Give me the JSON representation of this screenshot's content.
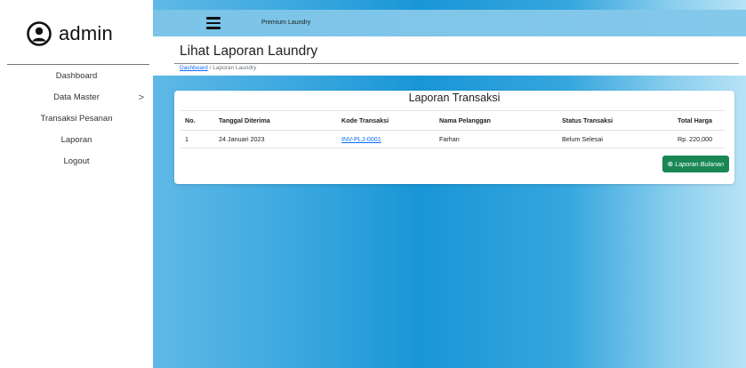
{
  "sidebar": {
    "brand": "admin",
    "items": [
      {
        "label": "Dashboard"
      },
      {
        "label": "Data Master",
        "chevron": ">"
      },
      {
        "label": "Transaksi Pesanan"
      },
      {
        "label": "Laporan"
      },
      {
        "label": "Logout"
      }
    ]
  },
  "topbar": {
    "app_name": "Premium Laundry"
  },
  "header": {
    "title": "Lihat Laporan Laundry",
    "breadcrumb": {
      "home": "Dashboard",
      "separator": " / ",
      "current": "Laporan Laundry"
    }
  },
  "card": {
    "title": "Laporan Transaksi",
    "columns": [
      "No.",
      "Tanggal Diterima",
      "Kode Transaksi",
      "Nama Pelanggan",
      "Status Transaksi",
      "Total Harga"
    ],
    "rows": [
      {
        "no": "1",
        "tanggal": "24 Januari 2023",
        "kode": "INV-PLJ-0001",
        "nama": "Farhan",
        "status": "Belum Selesai",
        "total": "Rp. 220,000"
      }
    ],
    "button_label": "Laporan Bulanan",
    "button_icon": "plus-circle-icon"
  },
  "colors": {
    "accent": "#1996d6",
    "button": "#198754",
    "link": "#0d6efd"
  }
}
